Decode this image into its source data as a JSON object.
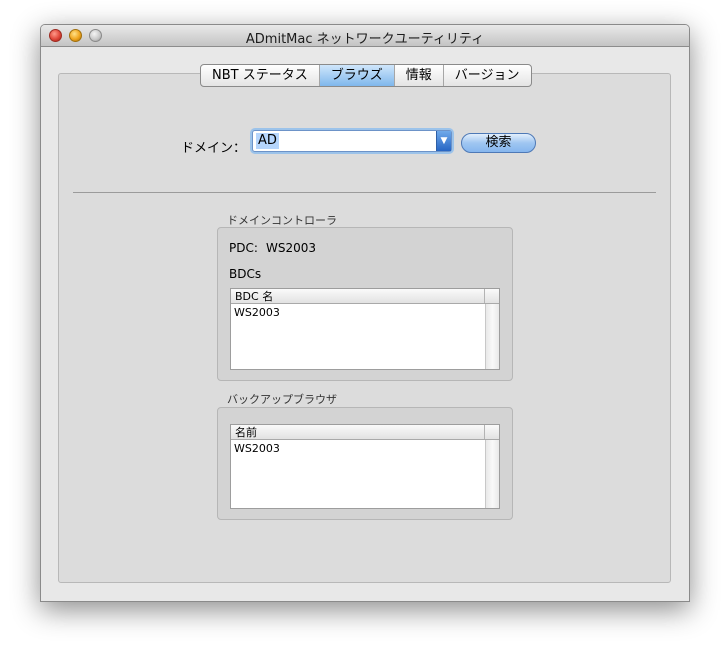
{
  "window": {
    "title": "ADmitMac ネットワークユーティリティ"
  },
  "tabs": [
    {
      "label": "NBT ステータス",
      "selected": false
    },
    {
      "label": "ブラウズ",
      "selected": true
    },
    {
      "label": "情報",
      "selected": false
    },
    {
      "label": "バージョン",
      "selected": false
    }
  ],
  "domain": {
    "label": "ドメイン：",
    "value": "AD",
    "dropdown_icon": "dropdown-arrow-icon"
  },
  "search_button": {
    "label": "検索"
  },
  "domain_controller": {
    "section_label": "ドメインコントローラ",
    "pdc_label": "PDC:",
    "pdc_value": "WS2003",
    "bdcs_label": "BDCs",
    "list": {
      "header": "BDC 名",
      "rows": [
        "WS2003"
      ]
    }
  },
  "backup_browser": {
    "section_label": "バックアップブラウザ",
    "list": {
      "header": "名前",
      "rows": [
        "WS2003"
      ]
    }
  },
  "colors": {
    "selected_tab": "#8dbff0",
    "search_button": "#9fc6f1",
    "text_highlight": "#b5d5fc"
  }
}
